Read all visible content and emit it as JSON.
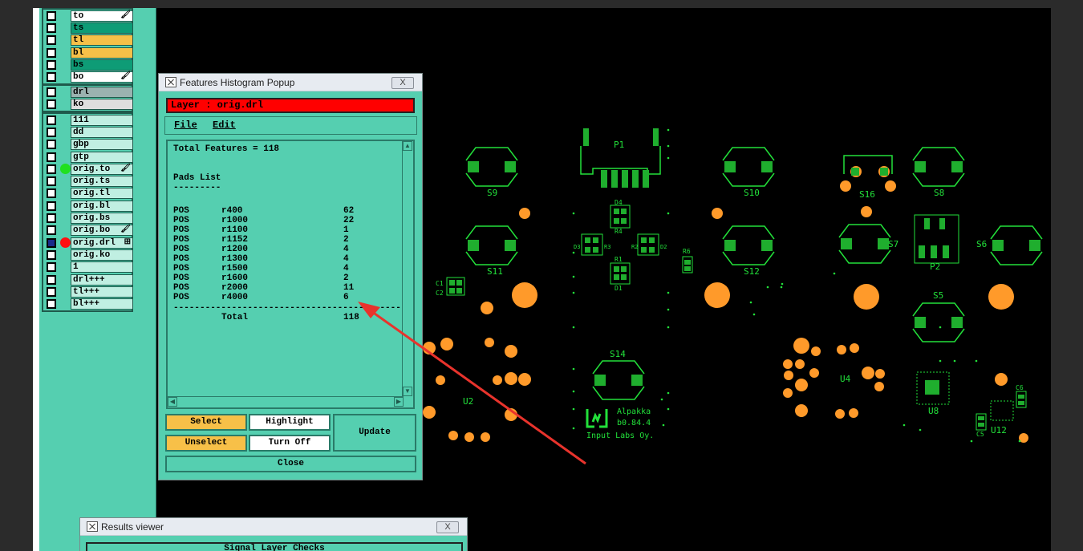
{
  "layers": {
    "group1": [
      {
        "name": "to",
        "color": "white",
        "flag": "🖌"
      },
      {
        "name": "ts",
        "color": "teal",
        "flag": ""
      },
      {
        "name": "tl",
        "color": "orange",
        "flag": ""
      },
      {
        "name": "bl",
        "color": "orange",
        "flag": ""
      },
      {
        "name": "bs",
        "color": "teal",
        "flag": ""
      },
      {
        "name": "bo",
        "color": "white",
        "flag": "🖌"
      }
    ],
    "group2": [
      {
        "name": "drl",
        "color": "gray",
        "flag": ""
      },
      {
        "name": "ko",
        "color": "lgray",
        "flag": ""
      }
    ],
    "group3": [
      {
        "name": "111",
        "color": "lightteal",
        "flag": ""
      },
      {
        "name": "dd",
        "color": "lightteal",
        "flag": ""
      },
      {
        "name": "gbp",
        "color": "lightteal",
        "flag": ""
      },
      {
        "name": "gtp",
        "color": "lightteal",
        "flag": ""
      },
      {
        "name": "orig.to",
        "color": "lightteal",
        "flag": "🖌",
        "dot": "#20e020"
      },
      {
        "name": "orig.ts",
        "color": "lightteal",
        "flag": ""
      },
      {
        "name": "orig.tl",
        "color": "lightteal",
        "flag": ""
      },
      {
        "name": "orig.bl",
        "color": "lightteal",
        "flag": ""
      },
      {
        "name": "orig.bs",
        "color": "lightteal",
        "flag": ""
      },
      {
        "name": "orig.bo",
        "color": "lightteal",
        "flag": "🖌"
      },
      {
        "name": "orig.drl",
        "color": "lightteal",
        "flag": "⊞",
        "dot": "#ff1010",
        "checked": true
      },
      {
        "name": "orig.ko",
        "color": "lightteal",
        "flag": ""
      },
      {
        "name": "1",
        "color": "lightteal",
        "flag": ""
      },
      {
        "name": "drl+++",
        "color": "lightteal",
        "flag": ""
      },
      {
        "name": "tl+++",
        "color": "lightteal",
        "flag": ""
      },
      {
        "name": "bl+++",
        "color": "lightteal",
        "flag": ""
      }
    ]
  },
  "popup": {
    "title": "Features Histogram Popup",
    "close_glyph": "X",
    "layer_label": "Layer :  orig.drl",
    "menu": {
      "file": "File",
      "edit": "Edit"
    },
    "total_features": "Total Features = 118",
    "pads_list": "Pads List",
    "pads_underline": "---------",
    "rows": [
      {
        "type": "POS",
        "sym": "r400",
        "count": "62"
      },
      {
        "type": "POS",
        "sym": "r1000",
        "count": "22"
      },
      {
        "type": "POS",
        "sym": "r1100",
        "count": "1"
      },
      {
        "type": "POS",
        "sym": "r1152",
        "count": "2"
      },
      {
        "type": "POS",
        "sym": "r1200",
        "count": "4"
      },
      {
        "type": "POS",
        "sym": "r1300",
        "count": "4"
      },
      {
        "type": "POS",
        "sym": "r1500",
        "count": "4"
      },
      {
        "type": "POS",
        "sym": "r1600",
        "count": "2"
      },
      {
        "type": "POS",
        "sym": "r2000",
        "count": "11"
      },
      {
        "type": "POS",
        "sym": "r4000",
        "count": "6"
      }
    ],
    "separator": "-------------------------------------------",
    "total_label": "Total",
    "total_value": "118",
    "buttons": {
      "select": "Select",
      "unselect": "Unselect",
      "highlight": "Highlight",
      "turn_off": "Turn Off",
      "update": "Update",
      "close": "Close"
    }
  },
  "results_viewer": {
    "title": "Results viewer",
    "close_glyph": "X",
    "subtitle": "Signal Layer Checks"
  },
  "board": {
    "labels": [
      "P1",
      "S9",
      "S10",
      "S16",
      "S8",
      "D4",
      "R4",
      "S11",
      "S12",
      "S7",
      "S6",
      "P2",
      "R6",
      "R1",
      "D1",
      "D3",
      "R3",
      "R2",
      "D2",
      "C1",
      "C2",
      "S5",
      "S14",
      "U2",
      "U4",
      "U8",
      "C6",
      "C5",
      "U12"
    ],
    "logo_text": [
      "Alpakka",
      "b0.84.4",
      "Input Labs Oy."
    ],
    "colors": {
      "silk": "#22e03a",
      "drill": "#ff9a2a",
      "pad": "#1fae2e"
    }
  }
}
